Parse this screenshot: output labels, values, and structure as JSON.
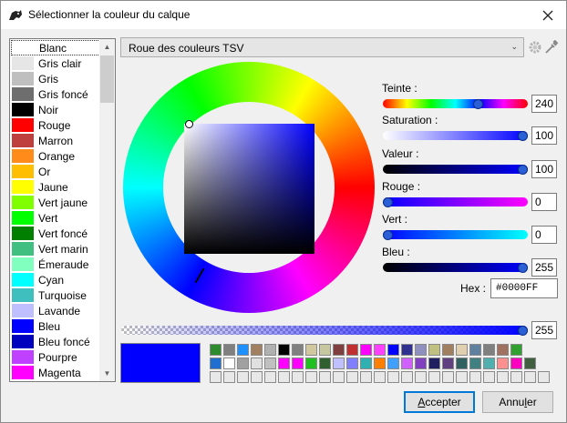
{
  "window": {
    "title": "Sélectionner la couleur du calque"
  },
  "color_list": {
    "items": [
      {
        "label": "Blanc",
        "color": "#ffffff",
        "selected": true
      },
      {
        "label": "Gris clair",
        "color": "#e6e6e6"
      },
      {
        "label": "Gris",
        "color": "#bfbfbf"
      },
      {
        "label": "Gris foncé",
        "color": "#6e6e6e"
      },
      {
        "label": "Noir",
        "color": "#000000"
      },
      {
        "label": "Rouge",
        "color": "#ff0000"
      },
      {
        "label": "Marron",
        "color": "#bf3f3f"
      },
      {
        "label": "Orange",
        "color": "#ff8c1a"
      },
      {
        "label": "Or",
        "color": "#ffbf00"
      },
      {
        "label": "Jaune",
        "color": "#ffff00"
      },
      {
        "label": "Vert jaune",
        "color": "#80ff00"
      },
      {
        "label": "Vert",
        "color": "#00ff00"
      },
      {
        "label": "Vert foncé",
        "color": "#007f00"
      },
      {
        "label": "Vert marin",
        "color": "#40bf80"
      },
      {
        "label": "Émeraude",
        "color": "#80ffbf"
      },
      {
        "label": "Cyan",
        "color": "#00ffff"
      },
      {
        "label": "Turquoise",
        "color": "#40bfbf"
      },
      {
        "label": "Lavande",
        "color": "#bfbfff"
      },
      {
        "label": "Bleu",
        "color": "#0000ff"
      },
      {
        "label": "Bleu foncé",
        "color": "#0000bf"
      },
      {
        "label": "Pourpre",
        "color": "#bf40ff"
      },
      {
        "label": "Magenta",
        "color": "#ff00ff"
      }
    ]
  },
  "mode_combo": {
    "value": "Roue des couleurs TSV"
  },
  "sliders": [
    {
      "key": "hue",
      "label": "Teinte :",
      "value": "240",
      "fraction": 0.667,
      "gradient": "linear-gradient(to right,#ff0000,#ffff00,#00ff00,#00ffff,#0000ff,#ff00ff,#ff0000)"
    },
    {
      "key": "saturation",
      "label": "Saturation :",
      "value": "100",
      "fraction": 1.0,
      "gradient": "linear-gradient(to right,#ffffff,#0000ff)"
    },
    {
      "key": "value",
      "label": "Valeur :",
      "value": "100",
      "fraction": 1.0,
      "gradient": "linear-gradient(to right,#000000,#0000ff)"
    },
    {
      "key": "red",
      "label": "Rouge :",
      "value": "0",
      "fraction": 0.0,
      "gradient": "linear-gradient(to right,#0000ff,#ff00ff)"
    },
    {
      "key": "green",
      "label": "Vert :",
      "value": "0",
      "fraction": 0.0,
      "gradient": "linear-gradient(to right,#0000ff,#00ffff)"
    },
    {
      "key": "blue",
      "label": "Bleu :",
      "value": "255",
      "fraction": 1.0,
      "gradient": "linear-gradient(to right,#000000,#0000ff)"
    }
  ],
  "hex": {
    "label": "Hex :",
    "value": "#0000FF"
  },
  "alpha": {
    "value": "255",
    "fraction": 1.0
  },
  "current_color": "#0000ff",
  "palette": {
    "rows": [
      [
        "#2e8b2e",
        "#808080",
        "#1e90ff",
        "#a08060",
        "#b0b0b0",
        "#000000",
        "#808080",
        "#d2c8a0",
        "#c8c8a0",
        "#7f3f3f",
        "#c03030",
        "#ff00ff",
        "#ff40ff",
        "#0000ff",
        "#303090",
        "#9090c0",
        "#c0c080",
        "#a08060",
        "#e0d0b0",
        "#6080a0",
        "#808080",
        "#a07060",
        "#30a030"
      ],
      [
        "#1e6fd0",
        "#ffffff",
        "#a0a0a0",
        "#e0e0e0",
        "#c0c0c0",
        "#ff00ff",
        "#ff00ff",
        "#20c020",
        "#306030",
        "#c0c0ff",
        "#8080ff",
        "#30b0b0",
        "#ff8000",
        "#40a0ff",
        "#d060ff",
        "#8040c0",
        "#202060",
        "#604080",
        "#306060",
        "#408080",
        "#50b0b0",
        "#ff9090",
        "#ff00c0",
        "#406040"
      ],
      [
        "#e8e8e8",
        "#e8e8e8",
        "#e8e8e8",
        "#e8e8e8",
        "#e8e8e8",
        "#e8e8e8",
        "#e8e8e8",
        "#e8e8e8",
        "#e8e8e8",
        "#e8e8e8",
        "#e8e8e8",
        "#e8e8e8",
        "#e8e8e8",
        "#e8e8e8",
        "#e8e8e8",
        "#e8e8e8",
        "#e8e8e8",
        "#e8e8e8",
        "#e8e8e8",
        "#e8e8e8",
        "#e8e8e8",
        "#e8e8e8",
        "#e8e8e8",
        "#e8e8e8",
        "#e8e8e8"
      ]
    ]
  },
  "buttons": {
    "accept_label": "ccepter",
    "accept_mnemonic": "A",
    "cancel_label_prefix": "Annu",
    "cancel_mnemonic": "l",
    "cancel_label_suffix": "er"
  },
  "icons": {
    "app": "rhino-icon",
    "close": "close-icon",
    "gear": "gear-icon",
    "pipette": "eyedropper-icon"
  }
}
